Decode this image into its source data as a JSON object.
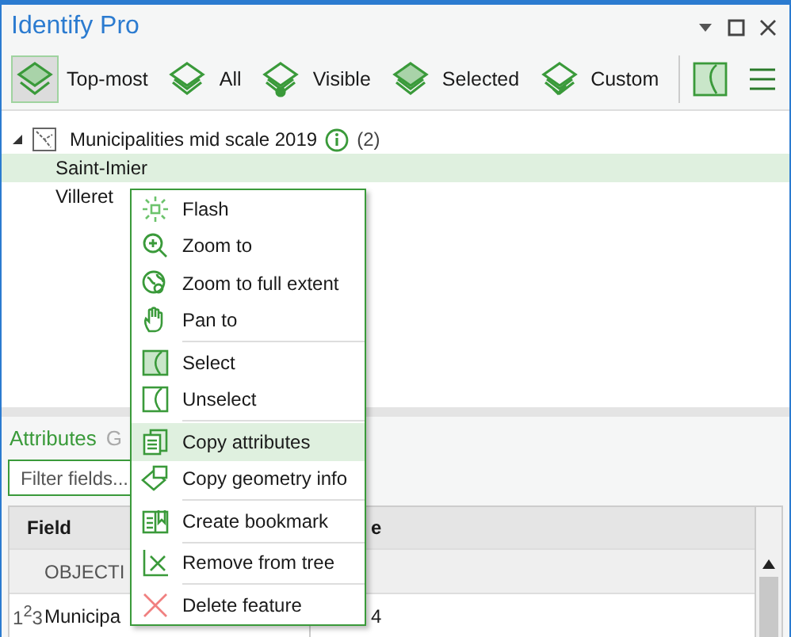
{
  "window": {
    "title": "Identify Pro"
  },
  "toolbar": {
    "buttons": [
      {
        "label": "Top-most",
        "selected": true
      },
      {
        "label": "All",
        "selected": false
      },
      {
        "label": "Visible",
        "selected": false
      },
      {
        "label": "Selected",
        "selected": false
      },
      {
        "label": "Custom",
        "selected": false
      }
    ]
  },
  "tree": {
    "layer": {
      "name": "Municipalities mid scale 2019",
      "count": "(2)",
      "expanded": true,
      "children": [
        {
          "label": "Saint-Imier",
          "selected": true
        },
        {
          "label": "Villeret",
          "selected": false
        }
      ]
    }
  },
  "tabs": [
    {
      "label": "Attributes",
      "selected": true
    },
    {
      "label": "G",
      "selected": false
    }
  ],
  "filter": {
    "placeholder": "Filter fields..."
  },
  "table": {
    "columns": [
      "Field",
      "e"
    ],
    "rows": [
      {
        "kind": "id",
        "field": "OBJECTI"
      },
      {
        "kind": "number",
        "type_label": "1$^{2}$3",
        "field": "Municipa",
        "value": "4"
      }
    ]
  },
  "context_menu": {
    "items": [
      {
        "label": "Flash",
        "highlighted": false,
        "separator_before": false
      },
      {
        "label": "Zoom to",
        "highlighted": false,
        "separator_before": false
      },
      {
        "label": "Zoom to full extent",
        "highlighted": false,
        "separator_before": false
      },
      {
        "label": "Pan to",
        "highlighted": false,
        "separator_before": false
      },
      {
        "label": "Select",
        "highlighted": false,
        "separator_before": true
      },
      {
        "label": "Unselect",
        "highlighted": false,
        "separator_before": false
      },
      {
        "label": "Copy attributes",
        "highlighted": true,
        "separator_before": true
      },
      {
        "label": "Copy geometry info",
        "highlighted": false,
        "separator_before": false
      },
      {
        "label": "Create bookmark",
        "highlighted": false,
        "separator_before": true
      },
      {
        "label": "Remove from tree",
        "highlighted": false,
        "separator_before": true
      },
      {
        "label": "Delete feature",
        "highlighted": false,
        "separator_before": true
      }
    ]
  }
}
